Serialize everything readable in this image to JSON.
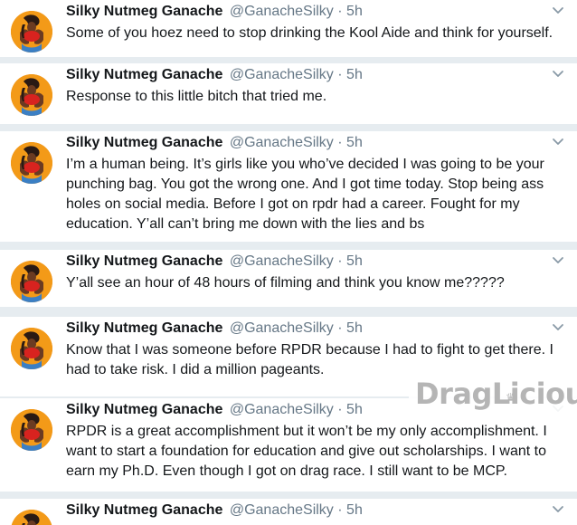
{
  "author": {
    "name": "Silky Nutmeg Ganache",
    "handle": "@GanacheSilky",
    "separator": "·",
    "time": "5h"
  },
  "colors": {
    "background": "#e6ecf0",
    "card": "#ffffff",
    "text": "#14171a",
    "muted": "#657786",
    "avatar_orange": "#f7a11a"
  },
  "icons": {
    "avatar": "profile-photo",
    "menu": "chevron-down-icon"
  },
  "tweets": [
    {
      "text": "Some of you hoez need to stop drinking the Kool Aide and think for yourself."
    },
    {
      "text": "Response to this little bitch that tried me."
    },
    {
      "text": "I’m a human being. It’s girls like you who’ve decided I was going to be your punching bag. You got the wrong one. And I got time today. Stop being ass holes on social media. Before I got on rpdr had a career. Fought for my education. Y’all can’t bring me down with the lies and bs"
    },
    {
      "text": "Y’all see an hour of 48 hours of filming and think you know me?????"
    },
    {
      "text": "Know that I was someone before RPDR because I had to fight to get there. I had to take risk. I did a million pageants."
    },
    {
      "text": "RPDR is a great accomplishment but it won’t be my only accomplishment. I want to start a foundation for education and give out scholarships. I want to earn my Ph.D. Even though I got on drag race. I still want to be MCP."
    },
    {
      "text": ""
    }
  ],
  "watermark": {
    "text": "DragLicious"
  }
}
